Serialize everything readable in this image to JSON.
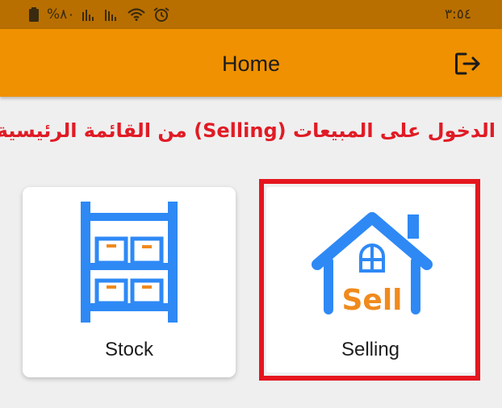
{
  "status_bar": {
    "battery": "%٨٠",
    "time": "٣:٥٤"
  },
  "header": {
    "title": "Home",
    "logout_icon": "logout-icon"
  },
  "instruction": "الدخول على المبيعات (Selling) من القائمة الرئيسية",
  "cards": [
    {
      "label": "Stock",
      "icon": "warehouse-shelves-icon"
    },
    {
      "label": "Selling",
      "icon": "house-sell-icon",
      "badge_text": "Sell"
    }
  ],
  "colors": {
    "status_bar": "#b86f00",
    "app_bar": "#ef9100",
    "instruction_text": "#e11b25",
    "highlight_border": "#e5161f",
    "icon_blue": "#2e89f5",
    "icon_orange": "#f08a1d"
  }
}
